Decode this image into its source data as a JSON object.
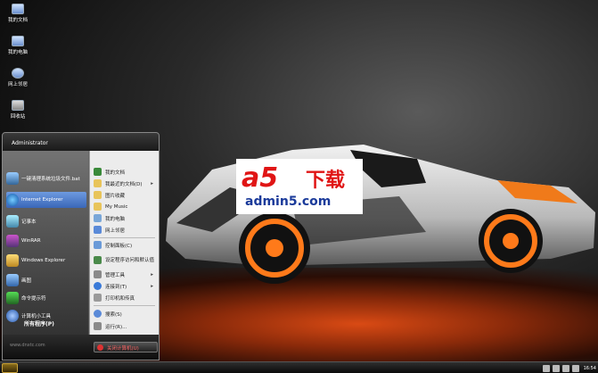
{
  "desktop_icons": [
    {
      "label": "我的文档",
      "icon": "my-documents-icon"
    },
    {
      "label": "我的电脑",
      "icon": "my-computer-icon"
    },
    {
      "label": "网上邻居",
      "icon": "network-icon"
    },
    {
      "label": "回收站",
      "icon": "recycle-bin-icon"
    }
  ],
  "watermark": {
    "logo_a5": "a5",
    "logo_text": "下载",
    "domain": "admin5.com"
  },
  "start_menu": {
    "user": "Administrator",
    "left_items": [
      {
        "label": "一键清理系统垃圾文件.bat",
        "icon": "broom-icon"
      },
      {
        "label": "Internet Explorer",
        "icon": "ie-icon"
      },
      {
        "label": "记事本",
        "icon": "notepad-icon"
      },
      {
        "label": "WinRAR",
        "icon": "winrar-icon"
      },
      {
        "label": "Windows Explorer",
        "icon": "explorer-icon"
      },
      {
        "label": "画图",
        "icon": "paint-icon"
      },
      {
        "label": "命令提示符",
        "icon": "cmd-icon"
      },
      {
        "label": "计算机小工具",
        "icon": "tool-icon"
      }
    ],
    "all_programs": "所有程序(P)",
    "right_items": [
      {
        "label": "我的文档",
        "icon": "documents-icon",
        "arrow": false
      },
      {
        "label": "我最近的文档(D)",
        "icon": "recent-docs-icon",
        "arrow": true
      },
      {
        "label": "图片收藏",
        "icon": "pictures-icon",
        "arrow": false
      },
      {
        "label": "My Music",
        "icon": "music-icon",
        "arrow": false
      },
      {
        "label": "我的电脑",
        "icon": "computer-icon",
        "arrow": false
      },
      {
        "label": "网上邻居",
        "icon": "network-icon",
        "arrow": false
      },
      {
        "label": "控制面板(C)",
        "icon": "control-panel-icon",
        "arrow": false
      },
      {
        "label": "设定程序访问和默认值",
        "icon": "defaults-icon",
        "arrow": false
      },
      {
        "label": "管理工具",
        "icon": "admin-tools-icon",
        "arrow": true
      },
      {
        "label": "连接到(T)",
        "icon": "connect-icon",
        "arrow": true
      },
      {
        "label": "打印机和传真",
        "icon": "printer-icon",
        "arrow": false
      },
      {
        "label": "搜索(S)",
        "icon": "search-icon",
        "arrow": false
      },
      {
        "label": "运行(R)...",
        "icon": "run-icon",
        "arrow": false
      }
    ],
    "footer_url": "www.dnxtc.com",
    "shutdown_label": "关闭计算机(U)"
  },
  "taskbar": {
    "clock": "16:54"
  }
}
